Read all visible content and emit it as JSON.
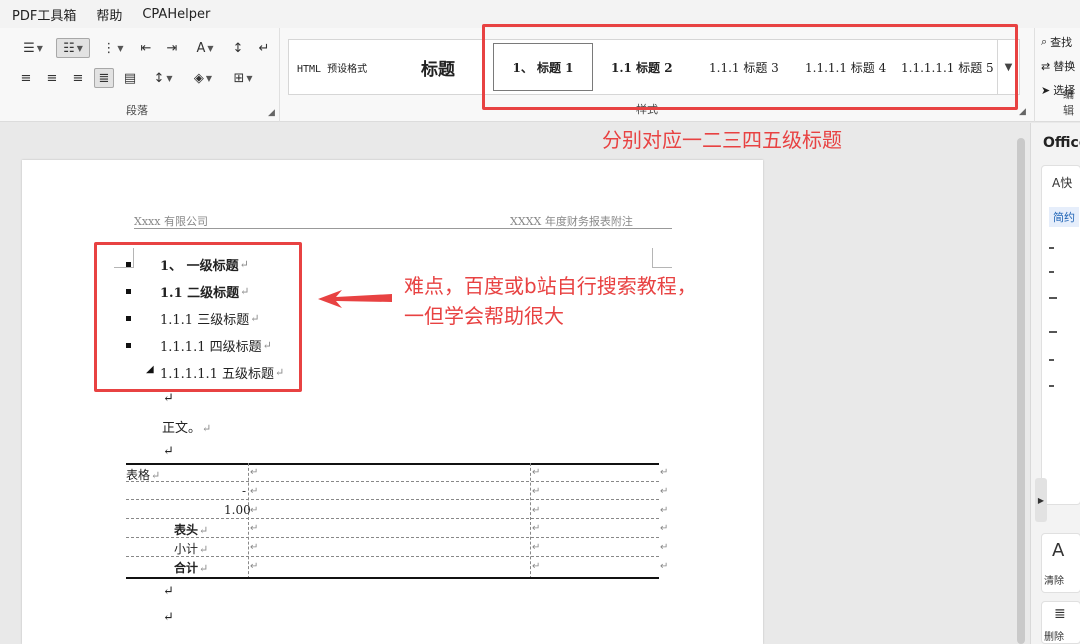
{
  "menu": {
    "items": [
      "PDF工具箱",
      "帮助",
      "CPAHelper"
    ]
  },
  "ribbon": {
    "paragraph_group_label": "段落",
    "styles_group_label": "样式",
    "edit_group_label": "编辑",
    "styles": [
      {
        "label": "HTML 预设格式"
      },
      {
        "label": "标题"
      },
      {
        "label": "1、 标题 1"
      },
      {
        "label": "1.1 标题 2"
      },
      {
        "label": "1.1.1 标题 3"
      },
      {
        "label": "1.1.1.1 标题 4"
      },
      {
        "label": "1.1.1.1.1 标题 5"
      }
    ],
    "edit_items": {
      "find": "查找",
      "replace": "替换",
      "select": "选择"
    }
  },
  "annotations": {
    "styles_note": "分别对应一二三四五级标题",
    "outline_note_line1": "难点，百度或b站自行搜索教程，",
    "outline_note_line2": "一但学会帮助很大"
  },
  "document": {
    "header_left": "Xxxx 有限公司",
    "header_right": "XXXX 年度财务报表附注",
    "headings": [
      {
        "text": "1、 一级标题",
        "level": 1
      },
      {
        "text": "1.1 二级标题",
        "level": 2
      },
      {
        "text": "1.1.1 三级标题",
        "level": 3
      },
      {
        "text": "1.1.1.1 四级标题",
        "level": 4
      },
      {
        "text": "1.1.1.1.1 五级标题",
        "level": 5
      }
    ],
    "body_text": "正文。",
    "paragraph_mark": "↵",
    "table": {
      "rows": [
        {
          "first": "表格"
        },
        {
          "first": "-"
        },
        {
          "first": "1.00"
        },
        {
          "first": "表头"
        },
        {
          "first": "小计"
        },
        {
          "first": "合计"
        }
      ]
    }
  },
  "side_pane": {
    "title": "Office",
    "quick_label": "快",
    "tab_label": "简约",
    "clear_label": "清除",
    "delete_label": "删除"
  }
}
